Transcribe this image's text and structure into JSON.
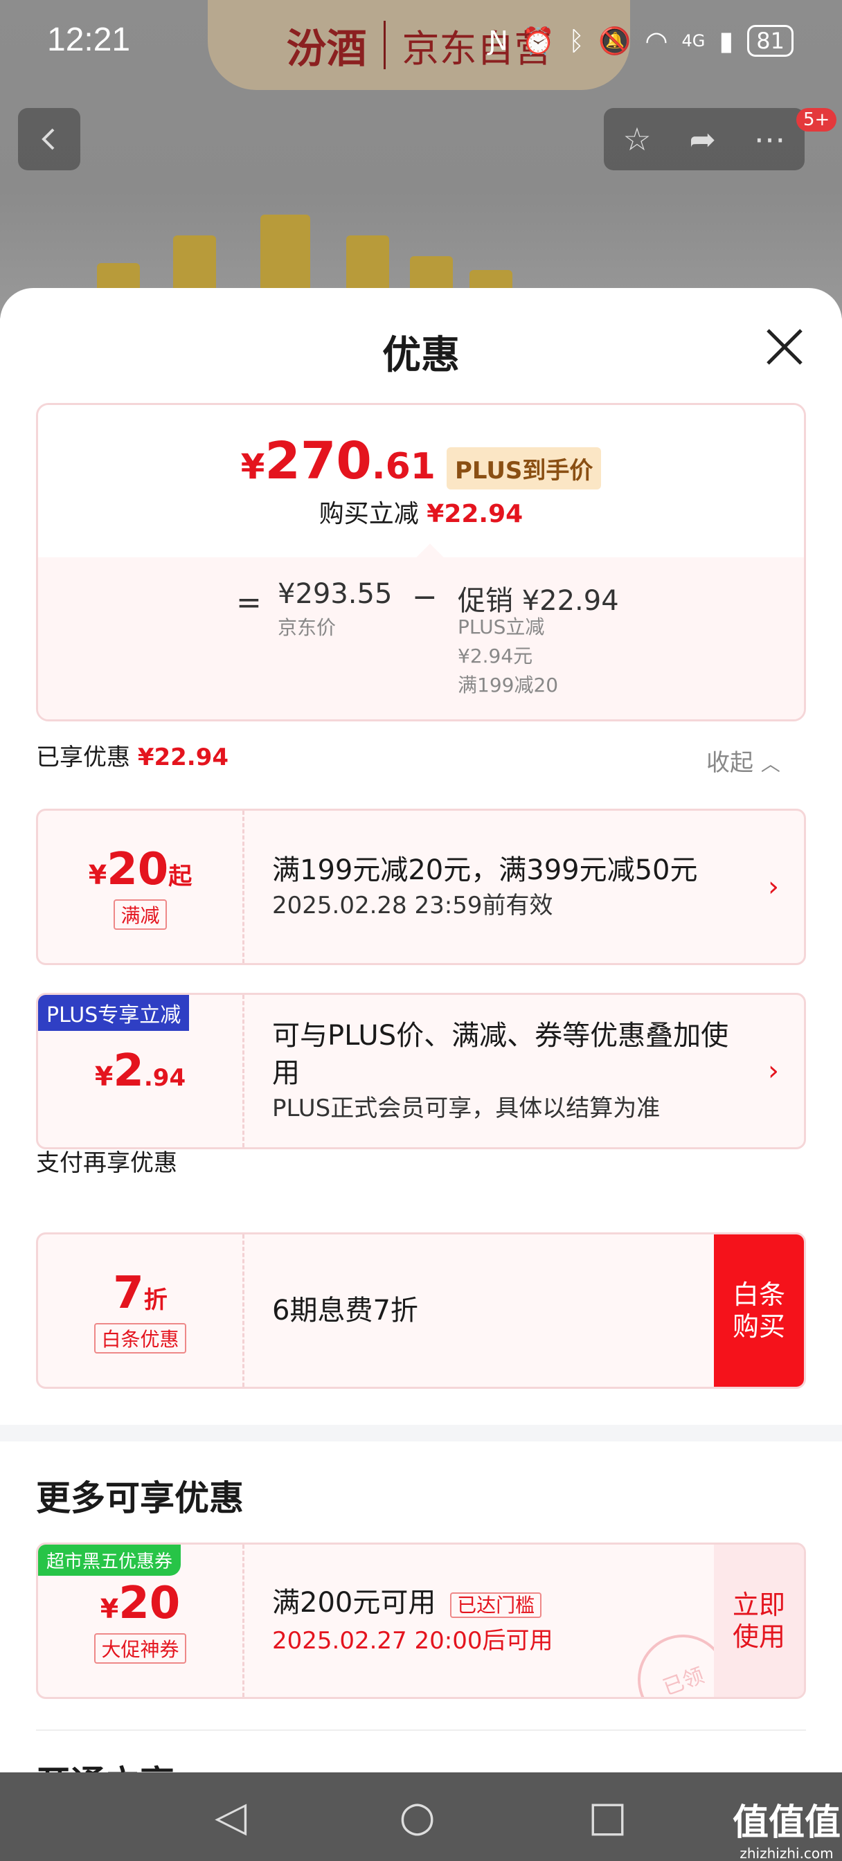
{
  "status_bar": {
    "time": "12:21",
    "network": "4G",
    "battery": "81"
  },
  "brand": {
    "logo": "汾酒",
    "store": "京东自营"
  },
  "top_nav": {
    "more_badge": "5+"
  },
  "sheet": {
    "title": "优惠",
    "price_summary": {
      "final_currency": "¥",
      "final_integer": "270",
      "final_decimal": ".61",
      "final_tag": "PLUS到手价",
      "instant_cut_label": "购买立减",
      "instant_cut_value": "¥22.94",
      "equals": "=",
      "jd_price": "¥293.55",
      "jd_price_label": "京东价",
      "minus": "−",
      "promo_label": "促销 ¥22.94",
      "promo_detail_1": "PLUS立减",
      "promo_detail_2": "¥2.94元",
      "promo_detail_3": "满199减20"
    },
    "enjoyed_label": "已享优惠",
    "enjoyed_value": "¥22.94",
    "collapse_label": "收起",
    "coupons": [
      {
        "currency": "¥",
        "amount": "20",
        "suffix": "起",
        "tag": "满减",
        "title": "满199元减20元，满399元减50元",
        "subtitle": "2025.02.28 23:59前有效"
      },
      {
        "corner": "PLUS专享立减",
        "currency": "¥",
        "amount": "2",
        "suffix": ".94",
        "title": "可与PLUS价、满减、券等优惠叠加使用",
        "subtitle": "PLUS正式会员可享，具体以结算为准"
      }
    ],
    "pay_section_title": "支付再享优惠",
    "pay_coupon": {
      "amount": "7",
      "suffix": "折",
      "tag": "白条优惠",
      "title": "6期息费7折",
      "button": "白条购买"
    },
    "more_section_title": "更多可享优惠",
    "more_coupon": {
      "corner": "超市黑五优惠券",
      "currency": "¥",
      "amount": "20",
      "tag": "大促神券",
      "title": "满200元可用",
      "title_tag": "已达门槛",
      "subtitle": "2025.02.27 20:00后可用",
      "button": "立即使用",
      "stamp": "已领"
    },
    "open_section_title": "开通立享"
  },
  "watermark": {
    "brand": "值值值",
    "url": "zhizhizhi.com"
  }
}
